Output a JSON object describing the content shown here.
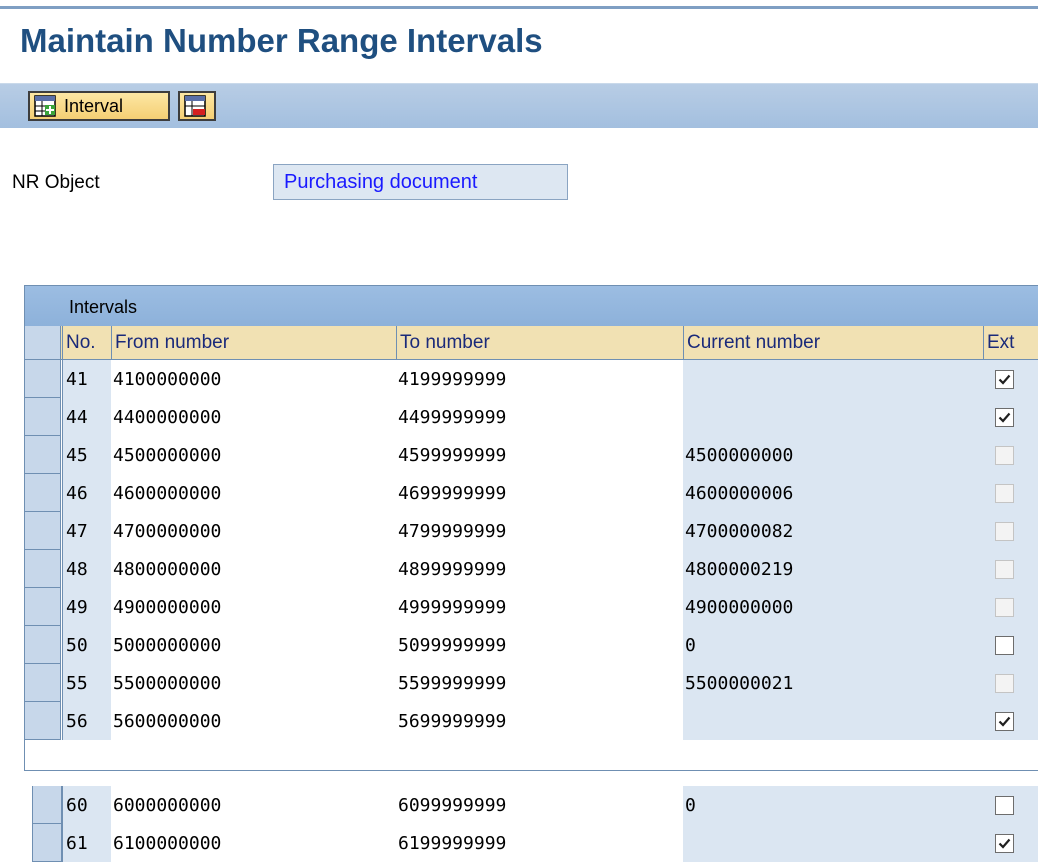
{
  "page": {
    "title": "Maintain Number Range Intervals"
  },
  "toolbar": {
    "interval_label": "Interval",
    "interval_icon": "insert-interval-icon",
    "delete_icon": "delete-interval-icon"
  },
  "nr_object": {
    "label": "NR Object",
    "value": "Purchasing document"
  },
  "table": {
    "title": "Intervals",
    "columns": [
      "No.",
      "From number",
      "To number",
      "Current number",
      "Ext"
    ],
    "rows": [
      {
        "no": "41",
        "from": "4100000000",
        "to": "4199999999",
        "current": "",
        "ext": true,
        "ext_enabled": true
      },
      {
        "no": "44",
        "from": "4400000000",
        "to": "4499999999",
        "current": "",
        "ext": true,
        "ext_enabled": true
      },
      {
        "no": "45",
        "from": "4500000000",
        "to": "4599999999",
        "current": "4500000000",
        "ext": false,
        "ext_enabled": false
      },
      {
        "no": "46",
        "from": "4600000000",
        "to": "4699999999",
        "current": "4600000006",
        "ext": false,
        "ext_enabled": false
      },
      {
        "no": "47",
        "from": "4700000000",
        "to": "4799999999",
        "current": "4700000082",
        "ext": false,
        "ext_enabled": false
      },
      {
        "no": "48",
        "from": "4800000000",
        "to": "4899999999",
        "current": "4800000219",
        "ext": false,
        "ext_enabled": false
      },
      {
        "no": "49",
        "from": "4900000000",
        "to": "4999999999",
        "current": "4900000000",
        "ext": false,
        "ext_enabled": false
      },
      {
        "no": "50",
        "from": "5000000000",
        "to": "5099999999",
        "current": "0",
        "ext": false,
        "ext_enabled": true
      },
      {
        "no": "55",
        "from": "5500000000",
        "to": "5599999999",
        "current": "5500000021",
        "ext": false,
        "ext_enabled": false
      },
      {
        "no": "56",
        "from": "5600000000",
        "to": "5699999999",
        "current": "",
        "ext": true,
        "ext_enabled": true
      }
    ],
    "extra_rows": [
      {
        "no": "60",
        "from": "6000000000",
        "to": "6099999999",
        "current": "0",
        "ext": false,
        "ext_enabled": true
      },
      {
        "no": "61",
        "from": "6100000000",
        "to": "6199999999",
        "current": "",
        "ext": true,
        "ext_enabled": true
      }
    ]
  },
  "colors": {
    "title": "#1f4f80",
    "toolbar": "#a3bfdf",
    "header": "#f1e1b3",
    "accent_blue": "#1a1aff"
  }
}
